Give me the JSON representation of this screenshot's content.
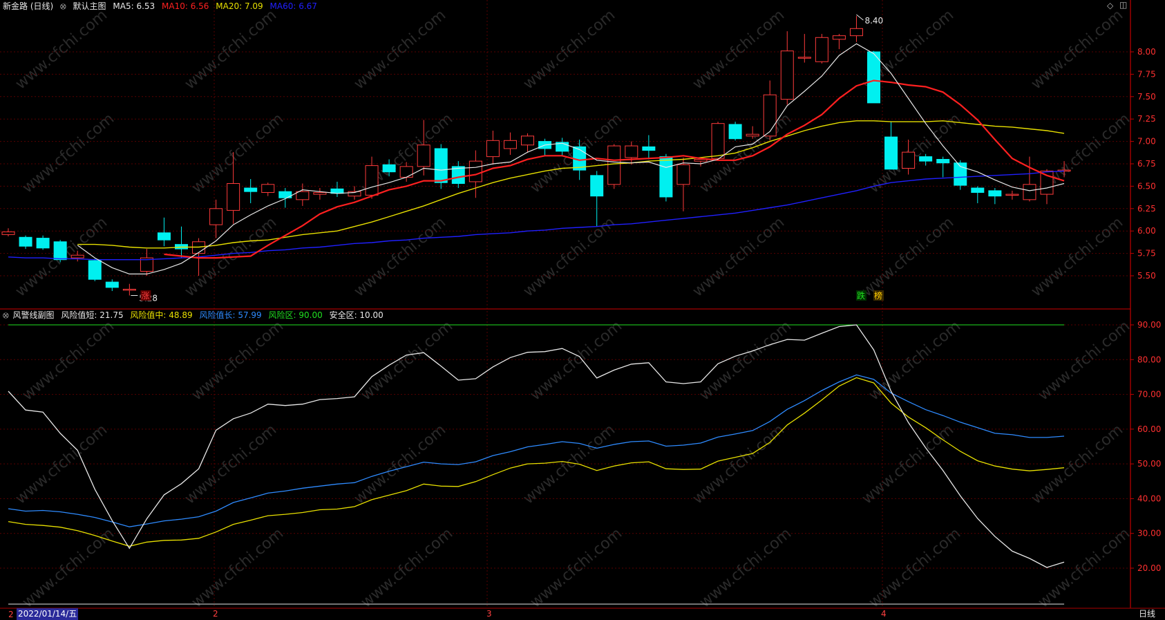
{
  "main_header": {
    "title": "新金路 (日线)",
    "chart_name": "默认主图",
    "ma5": {
      "label": "MA5: 6.53",
      "color": "#e8e8e8"
    },
    "ma10": {
      "label": "MA10: 6.56",
      "color": "#ff2020"
    },
    "ma20": {
      "label": "MA20: 7.09",
      "color": "#e8e000"
    },
    "ma60": {
      "label": "MA60: 6.67",
      "color": "#2020ff"
    }
  },
  "sub_header": {
    "title": "风警线副图",
    "short": {
      "label": "风险值短: 21.75",
      "color": "#e8e8e8"
    },
    "mid": {
      "label": "风险值中: 48.89",
      "color": "#e8e000"
    },
    "long": {
      "label": "风险值长: 57.99",
      "color": "#2e8bff"
    },
    "risk": {
      "label": "风险区: 90.00",
      "color": "#20e020"
    },
    "safe": {
      "label": "安全区: 10.00",
      "color": "#e8e8e8"
    }
  },
  "bottom_bar": {
    "date": "2022/01/14/五",
    "period": "日线",
    "month_labels": [
      "2",
      "3",
      "4"
    ]
  },
  "annotations": {
    "high": "8.40",
    "low": "5.28",
    "tags": [
      {
        "text": "涨",
        "color": "#ff4040",
        "bg": "#5a0000"
      },
      {
        "text": "跌",
        "color": "#20e020",
        "bg": "#003000"
      },
      {
        "text": "榜",
        "color": "#ffcc00",
        "bg": "#3a2a00"
      }
    ]
  },
  "watermark": "www.cfchi.com",
  "chart_data": [
    {
      "type": "candlestick",
      "title": "新金路 (日线)",
      "ylim": [
        5.28,
        8.6
      ],
      "y_ticks": [
        "8.00",
        "7.75",
        "7.50",
        "7.25",
        "7.00",
        "6.75",
        "6.50",
        "6.25",
        "6.00",
        "5.75",
        "5.50"
      ],
      "colors": {
        "up": "#ff3b3b",
        "down": "#00f0f0"
      },
      "candles": [
        [
          5.96,
          5.99,
          6.03,
          5.94
        ],
        [
          5.93,
          5.83,
          5.95,
          5.8
        ],
        [
          5.92,
          5.81,
          5.95,
          5.79
        ],
        [
          5.88,
          5.68,
          5.9,
          5.65
        ],
        [
          5.7,
          5.73,
          5.78,
          5.66
        ],
        [
          5.67,
          5.46,
          5.69,
          5.44
        ],
        [
          5.43,
          5.37,
          5.46,
          5.33
        ],
        [
          5.35,
          5.35,
          5.41,
          5.28
        ],
        [
          5.55,
          5.7,
          5.8,
          5.5
        ],
        [
          5.98,
          5.9,
          6.15,
          5.83
        ],
        [
          5.85,
          5.8,
          6.05,
          5.7
        ],
        [
          5.75,
          5.88,
          5.92,
          5.5
        ],
        [
          6.07,
          6.25,
          6.35,
          5.92
        ],
        [
          6.23,
          6.53,
          6.88,
          6.08
        ],
        [
          6.48,
          6.44,
          6.58,
          6.31
        ],
        [
          6.43,
          6.52,
          6.54,
          6.39
        ],
        [
          6.44,
          6.37,
          6.48,
          6.26
        ],
        [
          6.35,
          6.44,
          6.53,
          6.28
        ],
        [
          6.41,
          6.43,
          6.48,
          6.35
        ],
        [
          6.47,
          6.42,
          6.55,
          6.38
        ],
        [
          6.39,
          6.44,
          6.5,
          6.35
        ],
        [
          6.4,
          6.73,
          6.83,
          6.36
        ],
        [
          6.74,
          6.66,
          6.8,
          6.61
        ],
        [
          6.6,
          6.72,
          6.77,
          6.55
        ],
        [
          6.72,
          6.96,
          7.24,
          6.62
        ],
        [
          6.92,
          6.54,
          6.97,
          6.47
        ],
        [
          6.72,
          6.53,
          6.78,
          6.48
        ],
        [
          6.55,
          6.78,
          6.9,
          6.37
        ],
        [
          6.83,
          7.01,
          7.12,
          6.74
        ],
        [
          6.92,
          7.01,
          7.1,
          6.85
        ],
        [
          6.96,
          7.06,
          7.09,
          6.88
        ],
        [
          7.0,
          6.92,
          7.03,
          6.84
        ],
        [
          6.99,
          6.89,
          7.04,
          6.84
        ],
        [
          6.94,
          6.68,
          7.02,
          6.57
        ],
        [
          6.62,
          6.39,
          6.67,
          6.05
        ],
        [
          6.52,
          6.95,
          6.97,
          6.47
        ],
        [
          6.82,
          6.95,
          7.0,
          6.74
        ],
        [
          6.94,
          6.9,
          7.07,
          6.8
        ],
        [
          6.83,
          6.38,
          6.86,
          6.33
        ],
        [
          6.52,
          6.74,
          6.82,
          6.22
        ],
        [
          6.78,
          6.8,
          6.82,
          6.72
        ],
        [
          6.81,
          7.2,
          7.22,
          6.79
        ],
        [
          7.19,
          7.03,
          7.22,
          7.01
        ],
        [
          7.06,
          7.08,
          7.17,
          7.03
        ],
        [
          7.06,
          7.52,
          7.68,
          7.01
        ],
        [
          7.47,
          8.01,
          8.23,
          7.41
        ],
        [
          7.94,
          7.94,
          8.2,
          7.88
        ],
        [
          7.89,
          8.16,
          8.2,
          7.87
        ],
        [
          8.14,
          8.18,
          8.2,
          8.03
        ],
        [
          8.18,
          8.26,
          8.4,
          8.11
        ],
        [
          8.0,
          7.43,
          8.01,
          7.43
        ],
        [
          7.05,
          6.69,
          7.22,
          6.69
        ],
        [
          6.7,
          6.88,
          7.02,
          6.63
        ],
        [
          6.83,
          6.78,
          6.86,
          6.73
        ],
        [
          6.8,
          6.76,
          6.83,
          6.6
        ],
        [
          6.76,
          6.51,
          6.79,
          6.46
        ],
        [
          6.48,
          6.43,
          6.5,
          6.31
        ],
        [
          6.45,
          6.39,
          6.48,
          6.3
        ],
        [
          6.4,
          6.41,
          6.45,
          6.35
        ],
        [
          6.35,
          6.52,
          6.83,
          6.33
        ],
        [
          6.41,
          6.67,
          6.69,
          6.3
        ],
        [
          6.67,
          6.68,
          6.78,
          6.6
        ]
      ],
      "series": [
        {
          "name": "MA5",
          "color": "#e8e8e8",
          "values": [
            null,
            null,
            null,
            null,
            5.84,
            5.7,
            5.59,
            5.52,
            5.52,
            5.57,
            5.64,
            5.76,
            5.89,
            6.07,
            6.18,
            6.28,
            6.36,
            6.46,
            6.44,
            6.42,
            6.43,
            6.49,
            6.54,
            6.6,
            6.7,
            6.68,
            6.7,
            6.71,
            6.75,
            6.77,
            6.88,
            6.96,
            6.98,
            6.91,
            6.79,
            6.77,
            6.76,
            6.77,
            6.71,
            6.76,
            6.75,
            6.8,
            6.94,
            6.97,
            7.11,
            7.4,
            7.56,
            7.73,
            7.96,
            8.09,
            7.98,
            7.76,
            7.48,
            7.2,
            6.95,
            6.72,
            6.66,
            6.57,
            6.49,
            6.45,
            6.48,
            6.53
          ]
        },
        {
          "name": "MA10",
          "color": "#ff2020",
          "values": [
            null,
            null,
            null,
            null,
            null,
            null,
            null,
            null,
            null,
            5.74,
            5.72,
            5.7,
            5.7,
            5.71,
            5.72,
            5.84,
            5.95,
            6.06,
            6.19,
            6.27,
            6.32,
            6.39,
            6.46,
            6.5,
            6.56,
            6.56,
            6.6,
            6.63,
            6.7,
            6.73,
            6.8,
            6.84,
            6.84,
            6.79,
            6.81,
            6.79,
            6.8,
            6.81,
            6.82,
            6.84,
            6.81,
            6.79,
            6.79,
            6.84,
            6.94,
            7.08,
            7.18,
            7.3,
            7.48,
            7.62,
            7.68,
            7.66,
            7.63,
            7.61,
            7.55,
            7.41,
            7.24,
            7.02,
            6.81,
            6.71,
            6.62,
            6.56
          ]
        },
        {
          "name": "MA20",
          "color": "#e8e000",
          "values": [
            null,
            null,
            null,
            null,
            5.85,
            5.85,
            5.84,
            5.82,
            5.81,
            5.81,
            5.82,
            5.82,
            5.84,
            5.87,
            5.89,
            5.9,
            5.93,
            5.96,
            5.98,
            6.0,
            6.05,
            6.1,
            6.16,
            6.22,
            6.28,
            6.35,
            6.42,
            6.48,
            6.54,
            6.59,
            6.63,
            6.67,
            6.7,
            6.71,
            6.73,
            6.75,
            6.76,
            6.78,
            6.79,
            6.8,
            6.82,
            6.84,
            6.87,
            6.93,
            7.0,
            7.06,
            7.12,
            7.17,
            7.21,
            7.23,
            7.23,
            7.22,
            7.22,
            7.22,
            7.23,
            7.21,
            7.19,
            7.17,
            7.16,
            7.14,
            7.12,
            7.09
          ]
        },
        {
          "name": "MA60",
          "color": "#2020ff",
          "values": [
            5.71,
            5.7,
            5.7,
            5.69,
            5.69,
            5.68,
            5.68,
            5.68,
            5.68,
            5.69,
            5.7,
            5.71,
            5.73,
            5.75,
            5.76,
            5.78,
            5.79,
            5.81,
            5.82,
            5.84,
            5.86,
            5.87,
            5.89,
            5.9,
            5.92,
            5.93,
            5.94,
            5.96,
            5.97,
            5.98,
            6.0,
            6.01,
            6.03,
            6.04,
            6.05,
            6.07,
            6.08,
            6.1,
            6.12,
            6.14,
            6.16,
            6.18,
            6.2,
            6.23,
            6.26,
            6.29,
            6.33,
            6.37,
            6.41,
            6.45,
            6.5,
            6.54,
            6.56,
            6.58,
            6.59,
            6.6,
            6.61,
            6.62,
            6.63,
            6.64,
            6.66,
            6.67
          ]
        }
      ]
    },
    {
      "type": "line",
      "title": "风警线副图",
      "ylim": [
        10,
        90
      ],
      "y_ticks": [
        "90.00",
        "80.00",
        "70.00",
        "60.00",
        "50.00",
        "40.00",
        "30.00",
        "20.00"
      ],
      "series": [
        {
          "name": "风险值短",
          "color": "#e8e8e8",
          "values": [
            70.9,
            65.5,
            64.9,
            58.8,
            53.9,
            42.7,
            33.7,
            25.7,
            34.2,
            41.1,
            44.3,
            48.6,
            59.7,
            63.0,
            64.6,
            67.2,
            66.8,
            67.2,
            68.5,
            68.8,
            69.3,
            75.1,
            78.4,
            81.3,
            82.0,
            78.1,
            74.1,
            74.5,
            77.9,
            80.6,
            82.1,
            82.3,
            83.2,
            80.9,
            74.7,
            77.0,
            78.7,
            79.1,
            73.6,
            73.1,
            73.6,
            78.8,
            81.0,
            82.5,
            84.3,
            85.8,
            85.6,
            87.6,
            89.5,
            90.0,
            82.8,
            70.9,
            61.9,
            54.6,
            48.1,
            40.8,
            34.3,
            29.1,
            24.9,
            22.8,
            20.2,
            21.75
          ]
        },
        {
          "name": "风险值中",
          "color": "#e8e000",
          "values": [
            33.4,
            32.6,
            32.3,
            31.8,
            30.8,
            29.4,
            27.8,
            26.3,
            27.5,
            28.0,
            28.1,
            28.6,
            30.4,
            32.6,
            33.8,
            35.1,
            35.5,
            36.0,
            36.8,
            37.0,
            37.7,
            39.7,
            41.0,
            42.3,
            44.2,
            43.6,
            43.5,
            44.9,
            46.9,
            48.8,
            50.0,
            50.2,
            50.7,
            49.9,
            48.1,
            49.4,
            50.3,
            50.6,
            48.6,
            48.4,
            48.5,
            50.8,
            51.9,
            53.0,
            56.2,
            61.2,
            64.6,
            68.4,
            72.4,
            74.8,
            73.3,
            67.5,
            63.5,
            60.4,
            56.9,
            53.6,
            50.9,
            49.4,
            48.5,
            48.0,
            48.4,
            48.89
          ]
        },
        {
          "name": "风险值长",
          "color": "#2e8bff",
          "values": [
            37.1,
            36.4,
            36.6,
            36.2,
            35.5,
            34.6,
            33.3,
            31.9,
            32.7,
            33.6,
            34.1,
            34.8,
            36.4,
            38.9,
            40.2,
            41.6,
            42.2,
            43.0,
            43.6,
            44.2,
            44.6,
            46.4,
            47.9,
            49.2,
            50.5,
            50.0,
            49.8,
            50.6,
            52.4,
            53.5,
            54.9,
            55.6,
            56.4,
            55.9,
            54.5,
            55.6,
            56.4,
            56.6,
            55.1,
            55.4,
            56.0,
            57.7,
            58.6,
            59.6,
            62.2,
            65.7,
            68.2,
            71.1,
            73.6,
            75.6,
            74.3,
            70.4,
            67.9,
            65.6,
            63.9,
            62.0,
            60.4,
            58.8,
            58.4,
            57.6,
            57.6,
            57.99
          ]
        },
        {
          "name": "风险区",
          "color": "#20e020",
          "values": [
            90.0
          ]
        },
        {
          "name": "安全区",
          "color": "#e8e8e8",
          "values": [
            10.0
          ]
        }
      ]
    }
  ]
}
